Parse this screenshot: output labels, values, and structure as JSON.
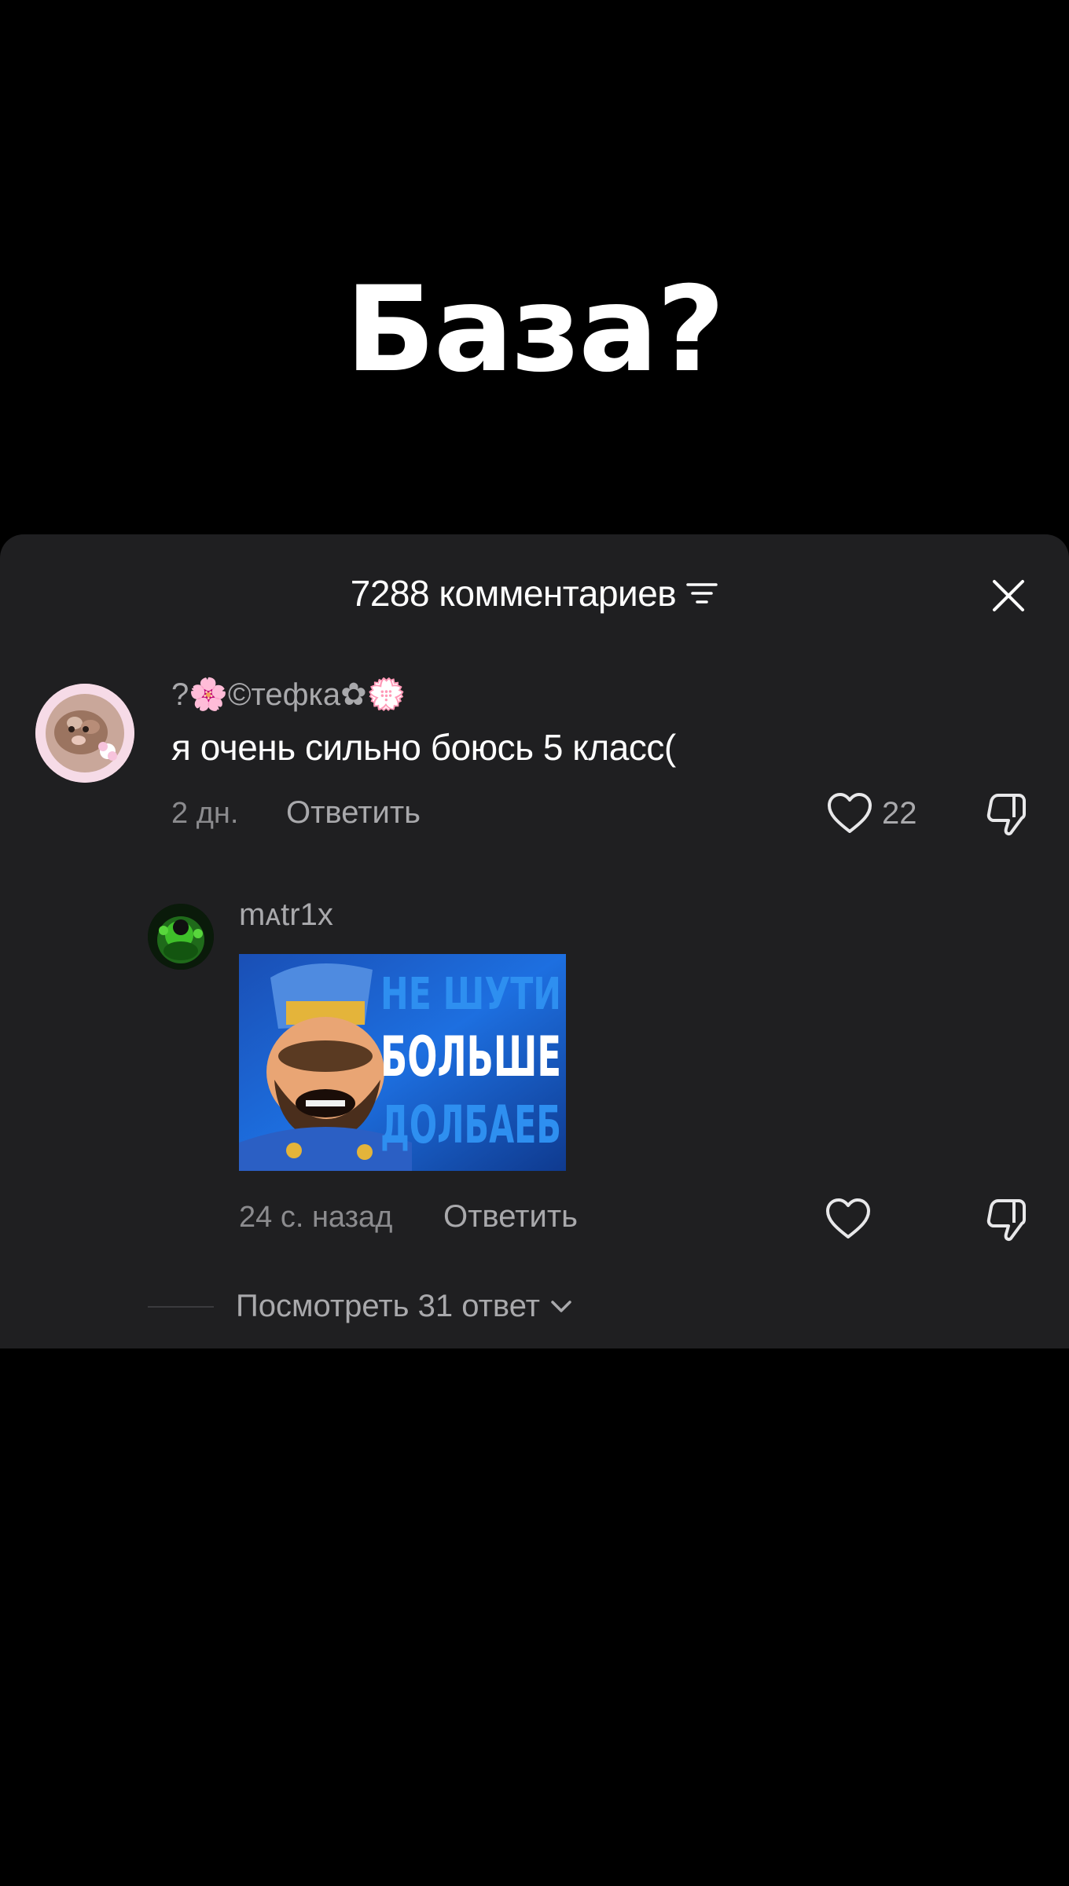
{
  "headline": "База?",
  "comments_sheet": {
    "title": "7288 комментариев",
    "filter_icon": "filter-icon",
    "close_icon": "close-icon"
  },
  "comment": {
    "username": "?🌸©тефка✿💮",
    "text": "я очень сильно боюсь 5 класс(",
    "time": "2 дн.",
    "reply_label": "Ответить",
    "likes": "22"
  },
  "reply": {
    "username": "mᴀtr1x",
    "sticker_text": [
      "НЕ ШУТИ",
      "БОЛЬШЕ",
      "ДОЛБАЕБ"
    ],
    "time": "24 с. назад",
    "reply_label": "Ответить"
  },
  "view_replies": {
    "label": "Посмотреть 31 ответ"
  },
  "colors": {
    "background": "#000000",
    "sheet": "#1f1f21",
    "secondary_text": "#a9a9ac",
    "primary_text": "#ffffff"
  }
}
